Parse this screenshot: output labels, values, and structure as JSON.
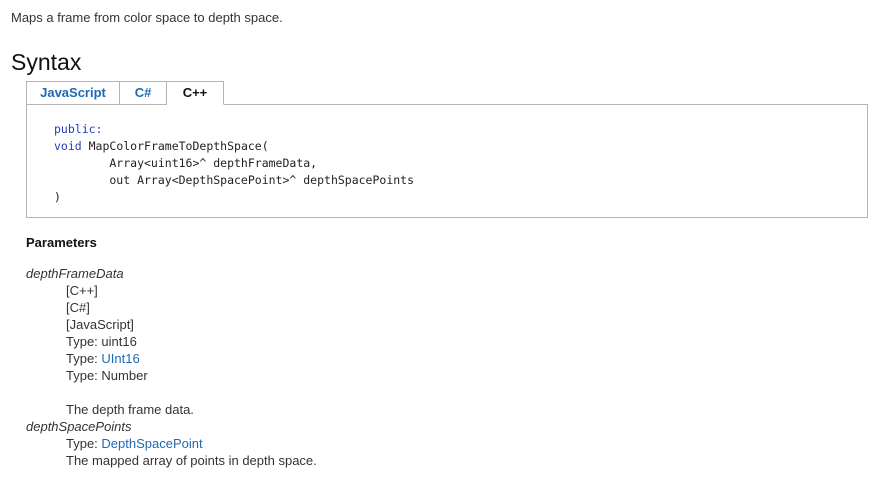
{
  "summary": "Maps a frame from color space to depth space.",
  "syntax": {
    "heading": "Syntax",
    "tabs": [
      {
        "label": "JavaScript",
        "selected": false
      },
      {
        "label": "C#",
        "selected": false
      },
      {
        "label": "C++",
        "selected": true
      }
    ],
    "code": {
      "line1_kw": "public:",
      "line2_kw": "void",
      "line2_rest": " MapColorFrameToDepthSpace(",
      "line3": "        Array<uint16>^ depthFrameData,",
      "line4": "        out Array<DepthSpacePoint>^ depthSpacePoints",
      "line5": ")"
    }
  },
  "parameters": {
    "heading": "Parameters",
    "items": [
      {
        "name": "depthFrameData",
        "lang_cpp": "[C++]",
        "lang_cs": "[C#]",
        "lang_js": "[JavaScript]",
        "type_prefix": "Type: ",
        "type_cpp": "uint16",
        "type_cs": "UInt16",
        "type_js": "Number",
        "description": "The depth frame data."
      },
      {
        "name": "depthSpacePoints",
        "type_prefix": "Type: ",
        "type": "DepthSpacePoint",
        "description": "The mapped array of points in depth space."
      }
    ]
  },
  "colors": {
    "link": "#1e6ab5",
    "keyword": "#1f3fbf",
    "border": "#b5b5b5"
  }
}
